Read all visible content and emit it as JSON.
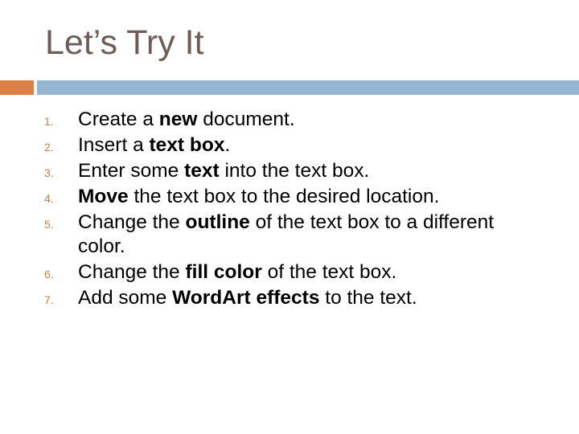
{
  "slide": {
    "title": "Let’s Try It",
    "accent_colors": {
      "orange": "#dd8047",
      "blue": "#94b6d2",
      "title": "#6e5d57",
      "number": "#c4814f"
    },
    "steps": [
      {
        "number": "1.",
        "parts": [
          "Create a ",
          "new",
          " document."
        ]
      },
      {
        "number": "2.",
        "parts": [
          "Insert a ",
          "text box",
          "."
        ]
      },
      {
        "number": "3.",
        "parts": [
          "Enter some ",
          "text",
          " into the text box."
        ]
      },
      {
        "number": "4.",
        "parts": [
          "",
          "Move",
          " the text box to the desired location."
        ]
      },
      {
        "number": "5.",
        "parts": [
          "Change the ",
          "outline",
          " of the text box to a different color."
        ]
      },
      {
        "number": "6.",
        "parts": [
          "Change the ",
          "fill color",
          " of the text box."
        ]
      },
      {
        "number": "7.",
        "parts": [
          "Add some ",
          "WordArt effects",
          " to the text."
        ]
      }
    ]
  }
}
